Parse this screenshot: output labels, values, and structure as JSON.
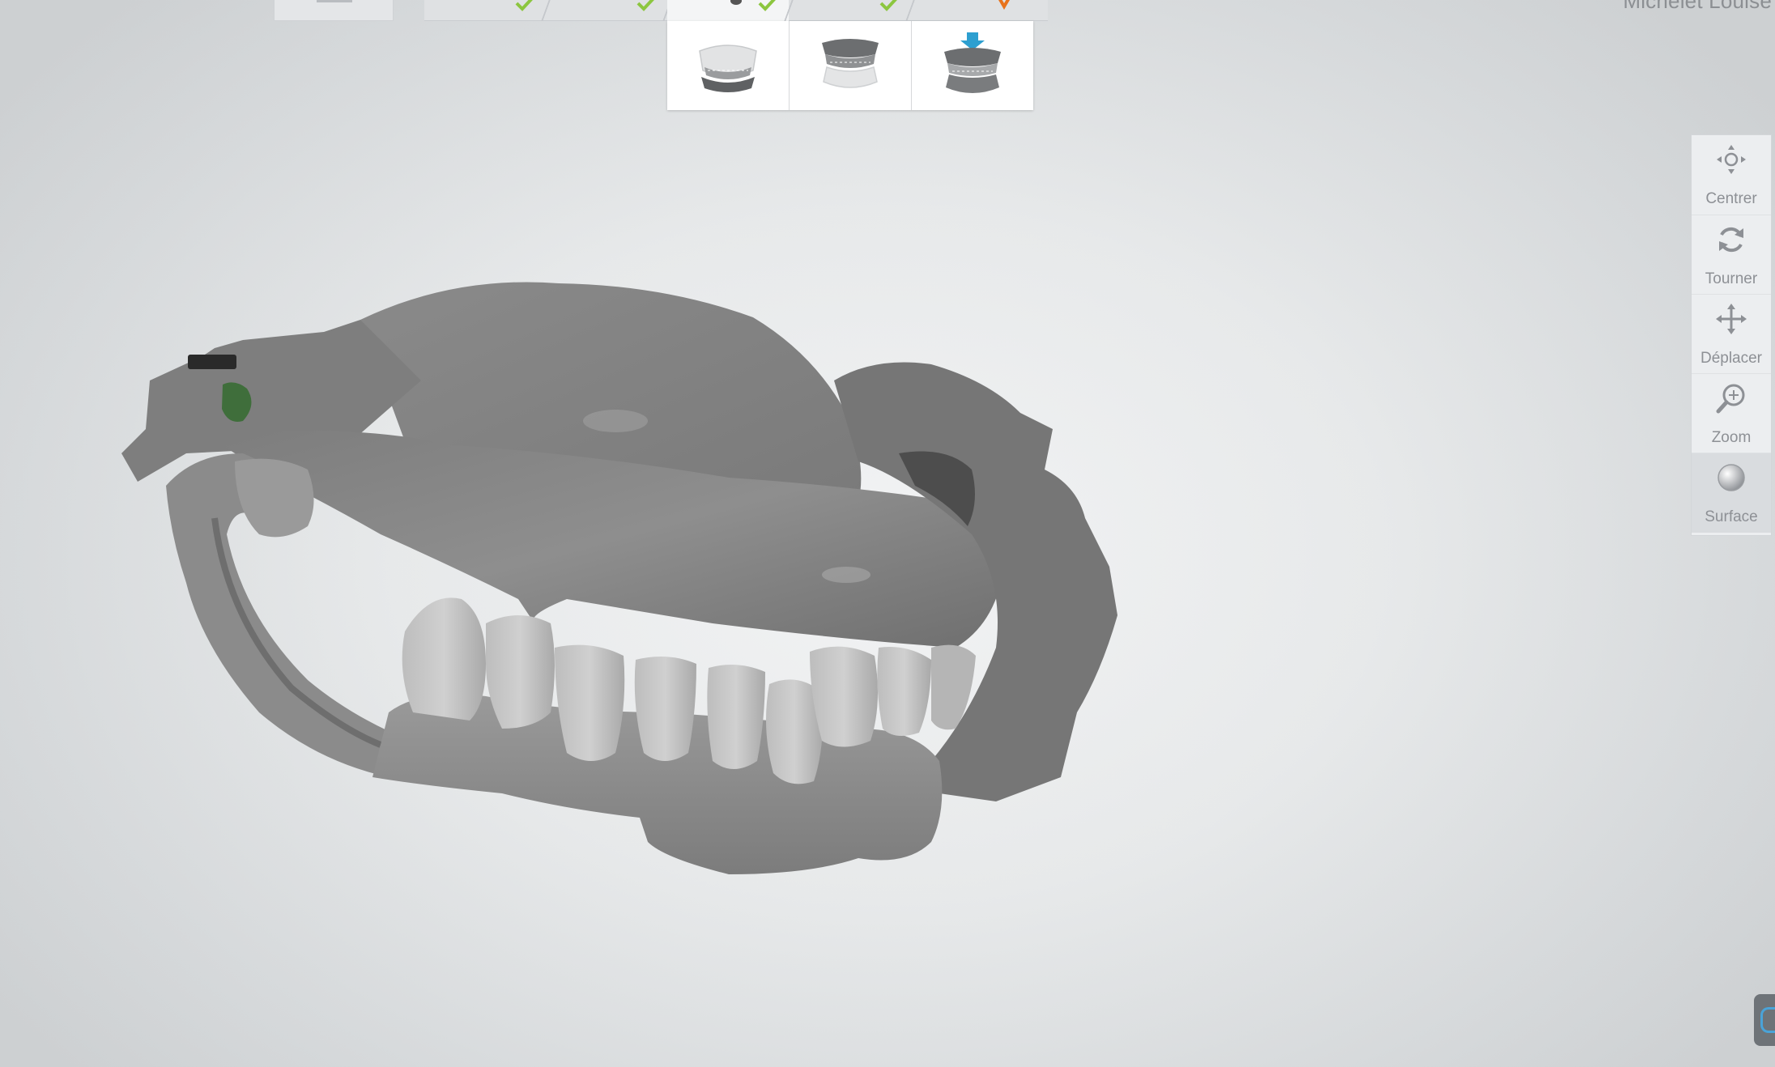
{
  "patient": {
    "name": "Michelet Louise"
  },
  "step_tabs": [
    {
      "status": "done",
      "icon": "check-icon"
    },
    {
      "status": "done",
      "icon": "check-icon"
    },
    {
      "status": "done",
      "icon": "check-icon"
    },
    {
      "status": "done",
      "icon": "check-icon"
    },
    {
      "status": "pending",
      "icon": "warning-icon"
    }
  ],
  "scan_modes": [
    {
      "icon": "upper-jaw-scan-icon"
    },
    {
      "icon": "lower-jaw-scan-icon"
    },
    {
      "icon": "bite-scan-icon",
      "selected": true
    }
  ],
  "toolbar": {
    "centrer": "Centrer",
    "tourner": "Tourner",
    "deplacer": "Déplacer",
    "zoom": "Zoom",
    "surface": "Surface"
  },
  "colors": {
    "check": "#8cc63f",
    "warning": "#e8731c",
    "accent_blue": "#2d9fd0"
  }
}
